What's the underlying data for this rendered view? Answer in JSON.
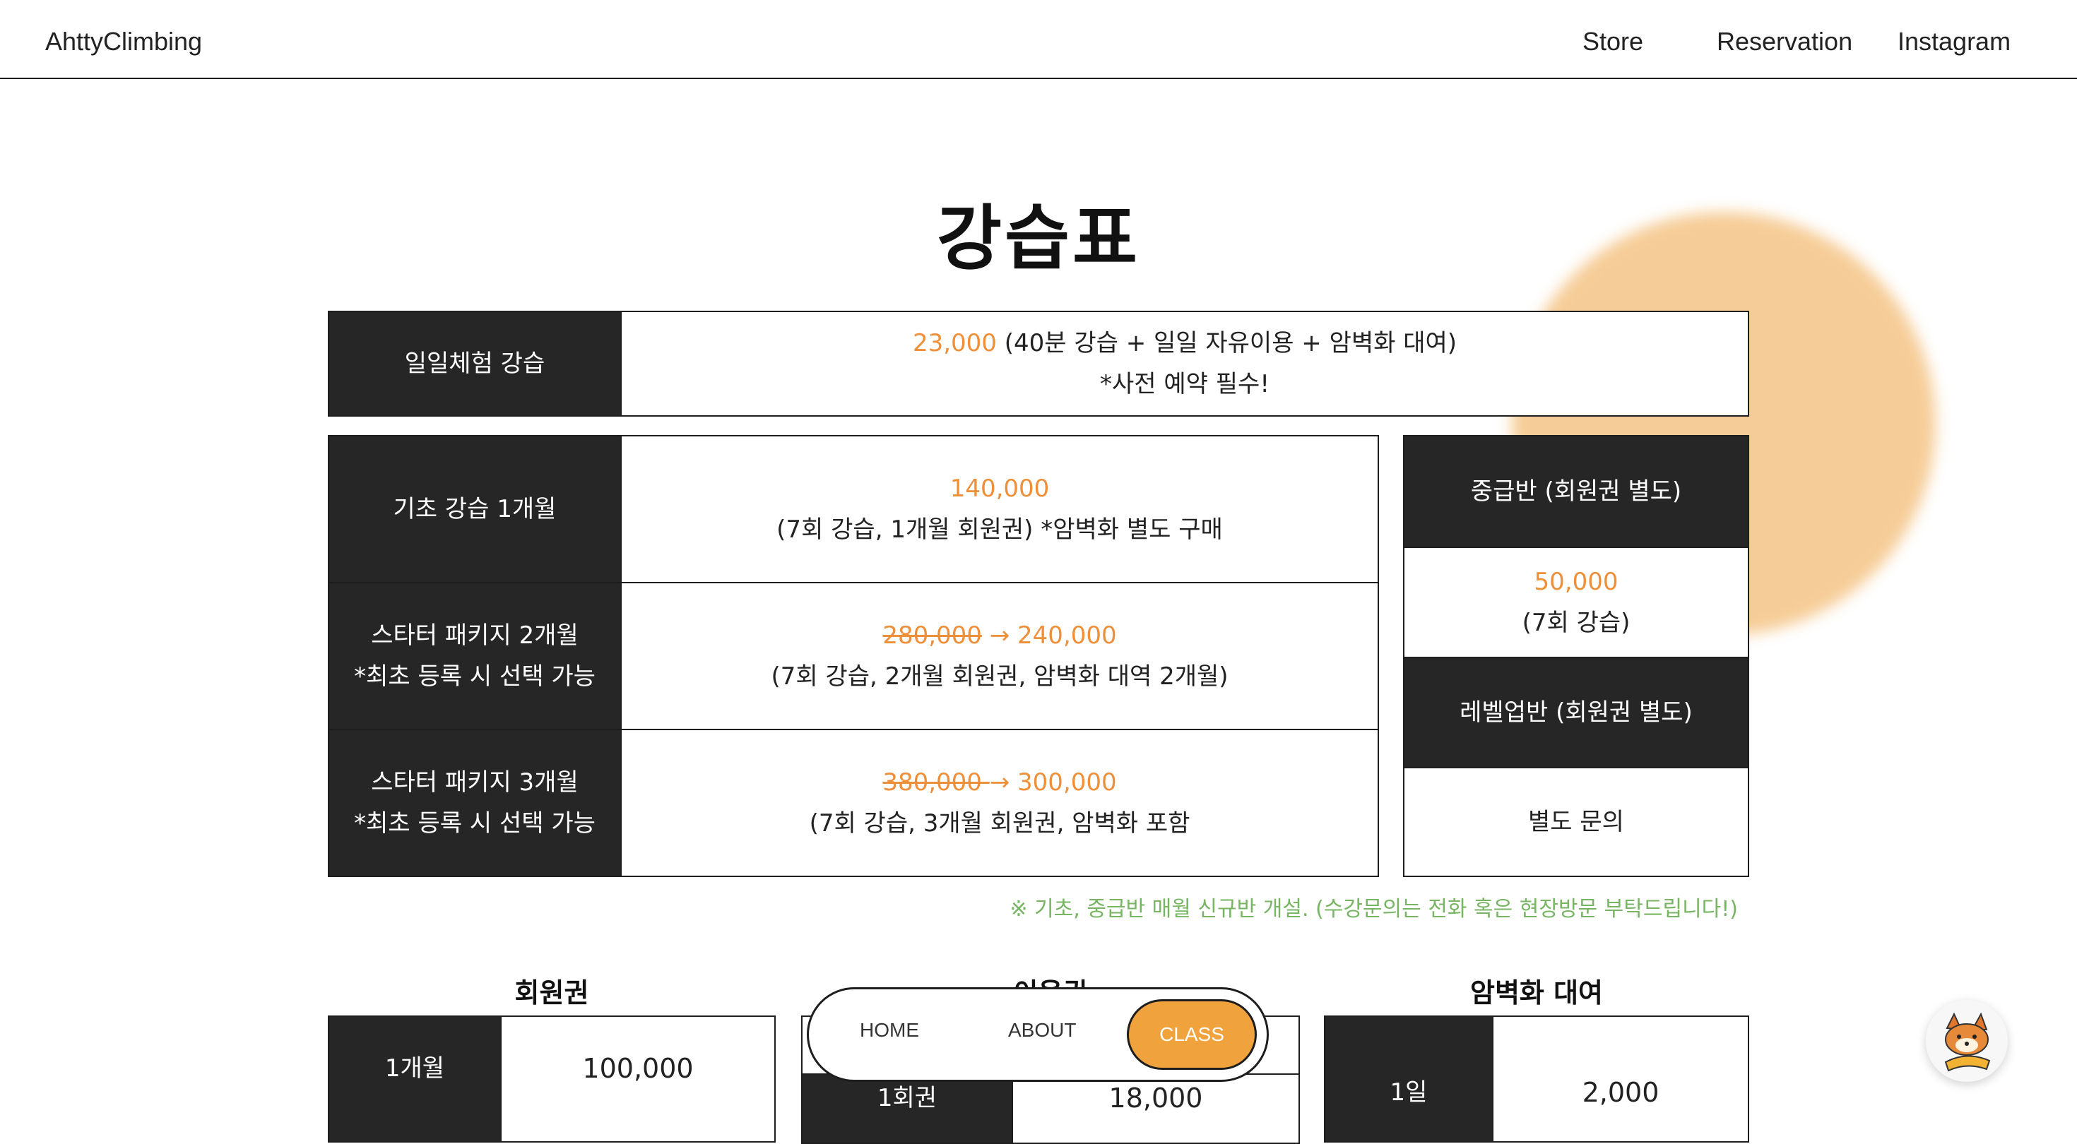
{
  "header": {
    "logo": "AhttyClimbing",
    "nav": {
      "store": "Store",
      "reservation": "Reservation",
      "instagram": "Instagram"
    }
  },
  "title": "강습표",
  "daily": {
    "label": "일일체험 강습",
    "price": "23,000",
    "detail": " (40분 강습 + 일일 자유이용 + 암벽화 대여)",
    "note": "*사전 예약 필수!"
  },
  "rows": [
    {
      "label_line1": "기초 강습 1개월",
      "label_line2": "",
      "old_price": "",
      "arrow": "",
      "price": "140,000",
      "detail": "(7회 강습, 1개월 회원권) *암벽화 별도 구매"
    },
    {
      "label_line1": "스타터 패키지 2개월",
      "label_line2": "*최초 등록 시 선택 가능",
      "old_price": "280,000",
      "arrow": " → ",
      "price": "240,000",
      "detail": "(7회 강습, 2개월 회원권, 암벽화 대역 2개월)"
    },
    {
      "label_line1": "스타터 패키지 3개월",
      "label_line2": "*최초 등록 시 선택 가능",
      "old_price": "380,000 ",
      "arrow": "→ ",
      "price": "300,000",
      "detail": "(7회 강습, 3개월 회원권, 암벽화 포함"
    }
  ],
  "side": {
    "intermediate_label": "중급반 (회원권 별도)",
    "intermediate_price": "50,000",
    "intermediate_detail": "(7회 강습)",
    "levelup_label": "레벨업반 (회원권 별도)",
    "levelup_detail": "별도 문의"
  },
  "note": "※ 기초, 중급반 매월 신규반 개설. (수강문의는 전화 혹은 현장방문 부탁드립니다!)",
  "membership": {
    "title": "회원권",
    "row_label": "1개월",
    "row_value": "100,000"
  },
  "usage": {
    "title": "이용권",
    "row_label": "1회권",
    "row_value": "18,000"
  },
  "shoes": {
    "title": "암벽화 대여",
    "row_label": "1일",
    "row_value": "2,000"
  },
  "bottom_nav": {
    "home": "HOME",
    "about": "ABOUT",
    "class": "CLASS"
  },
  "colors": {
    "accent": "#ee8f3a",
    "dark": "#262626",
    "note": "#77b563",
    "blob": "#f5c78c",
    "active_pill": "#f0a23c"
  },
  "icons": {
    "fab": "fox-mascot-icon"
  }
}
